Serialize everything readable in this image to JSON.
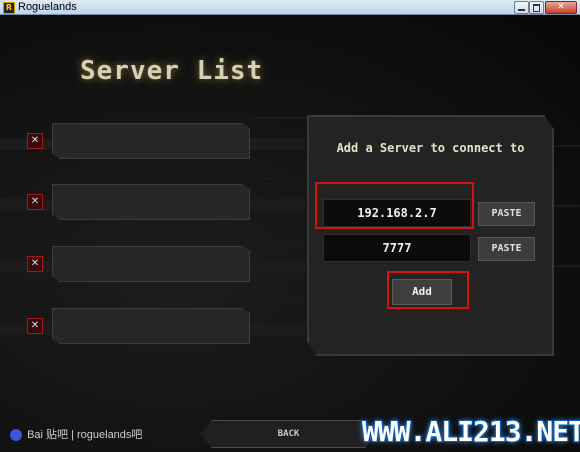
{
  "window": {
    "title": "Roguelands",
    "icon_letter": "R"
  },
  "screen": {
    "title": "Server List"
  },
  "server_slots": [
    {
      "value": ""
    },
    {
      "value": ""
    },
    {
      "value": ""
    },
    {
      "value": ""
    }
  ],
  "add_panel": {
    "title": "Add a Server to connect to",
    "ip_value": "192.168.2.7",
    "port_value": "7777",
    "paste_label": "PASTE",
    "add_label": "Add"
  },
  "back_label": "BACK",
  "watermarks": {
    "baidu": "Bai  贴吧 | roguelands吧",
    "ali": "WWW.ALI213.NET"
  },
  "colors": {
    "highlight": "#d21212",
    "title_glow": "#d6d0b4"
  }
}
